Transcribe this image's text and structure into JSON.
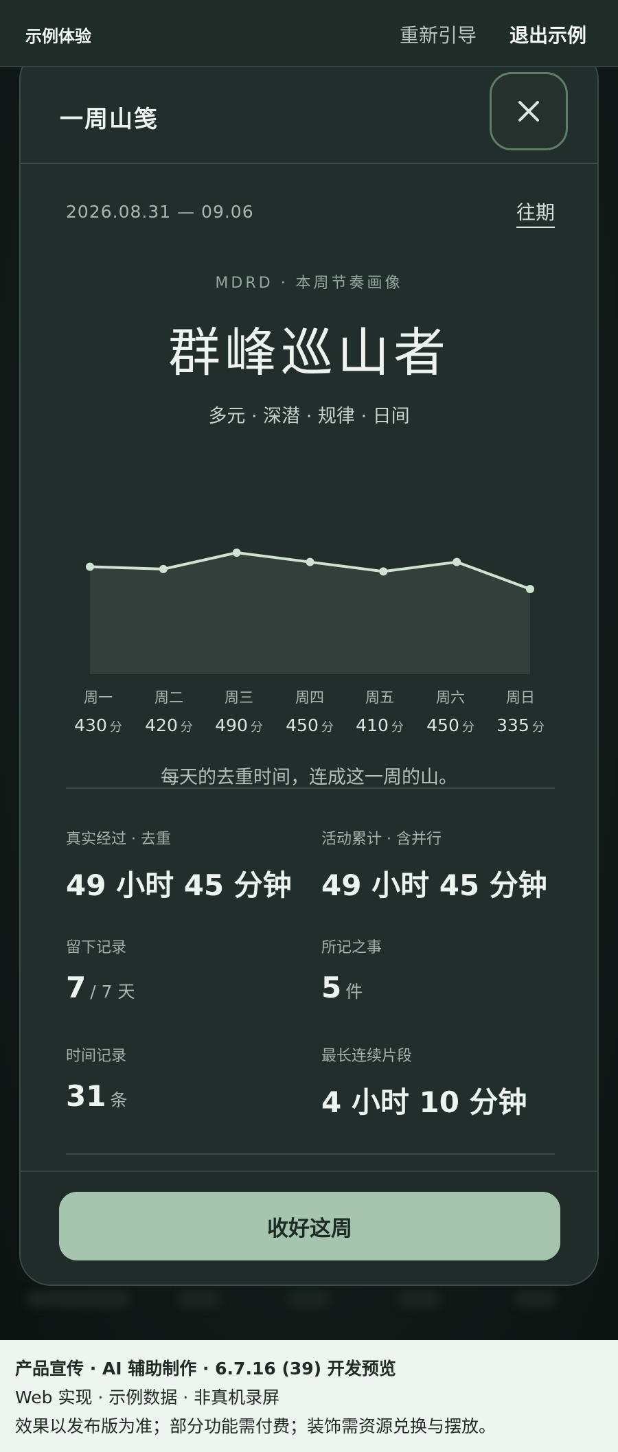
{
  "topbar": {
    "brand": "示例体验",
    "reguide": "重新引导",
    "exit": "退出示例"
  },
  "card": {
    "title": "一周山笺",
    "date_range": "2026.08.31 — 09.06",
    "past": "往期",
    "kicker": "MDRD · 本周节奏画像",
    "persona": "群峰巡山者",
    "traits": "多元 · 深潜 · 规律 · 日间",
    "caption": "每天的去重时间，连成这一周的山。",
    "unit_minute": "分"
  },
  "chart_data": {
    "type": "area",
    "categories": [
      "周一",
      "周二",
      "周三",
      "周四",
      "周五",
      "周六",
      "周日"
    ],
    "values": [
      430,
      420,
      490,
      450,
      410,
      450,
      335
    ],
    "value_labels": [
      "430",
      "420",
      "490",
      "450",
      "410",
      "450",
      "335"
    ],
    "xlabel": "",
    "ylabel": "",
    "grid": false,
    "colors": {
      "line": "#cfe3d2",
      "fill": "#323f3a",
      "point": "#cfe3d2"
    }
  },
  "stats": [
    {
      "label": "真实经过 · 去重",
      "value": "49 小时 45 分钟",
      "unit": ""
    },
    {
      "label": "活动累计 · 含并行",
      "value": "49 小时 45 分钟",
      "unit": ""
    },
    {
      "label": "留下记录",
      "value": "7",
      "unit": "/ 7 天"
    },
    {
      "label": "所记之事",
      "value": "5",
      "unit": "件"
    },
    {
      "label": "时间记录",
      "value": "31",
      "unit": "条"
    },
    {
      "label": "最长连续片段",
      "value": "4 小时 10 分钟",
      "unit": ""
    }
  ],
  "keep_button": "收好这周",
  "notice": {
    "line1": "产品宣传 · AI 辅助制作 · 6.7.16 (39) 开发预览",
    "line2": "Web 实现 · 示例数据 · 非真机录屏",
    "line3": "效果以发布版为准；部分功能需付费；装饰需资源兑换与摆放。"
  },
  "colors": {
    "accent": "#a6c5ae",
    "surface": "#222e2b",
    "background": "#101a17"
  }
}
